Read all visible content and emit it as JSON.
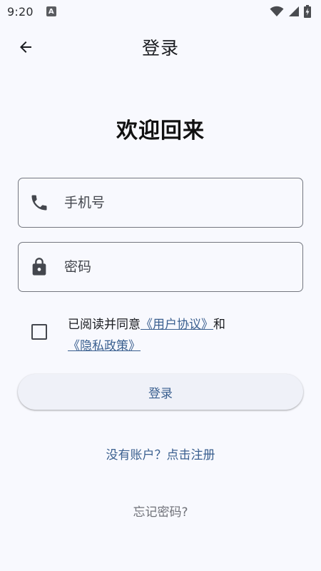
{
  "status_bar": {
    "time": "9:20",
    "notification_icon": "A"
  },
  "app_bar": {
    "title": "登录",
    "back_icon": "arrow-left-icon"
  },
  "welcome_title": "欢迎回来",
  "phone_field": {
    "placeholder": "手机号",
    "value": "",
    "icon": "phone-icon"
  },
  "password_field": {
    "placeholder": "密码",
    "value": "",
    "icon": "lock-icon"
  },
  "agreement": {
    "checked": false,
    "prefix": "已阅读并同意",
    "user_agreement": "《用户协议》",
    "conjunction": "和",
    "privacy_policy": "《隐私政策》"
  },
  "login_button": "登录",
  "register_link": "没有账户？点击注册",
  "forgot_password_link": "忘记密码?",
  "colors": {
    "background": "#f8f9fe",
    "accent": "#3a5f8f",
    "outline": "#74777f",
    "button_bg": "#eff1f8"
  }
}
